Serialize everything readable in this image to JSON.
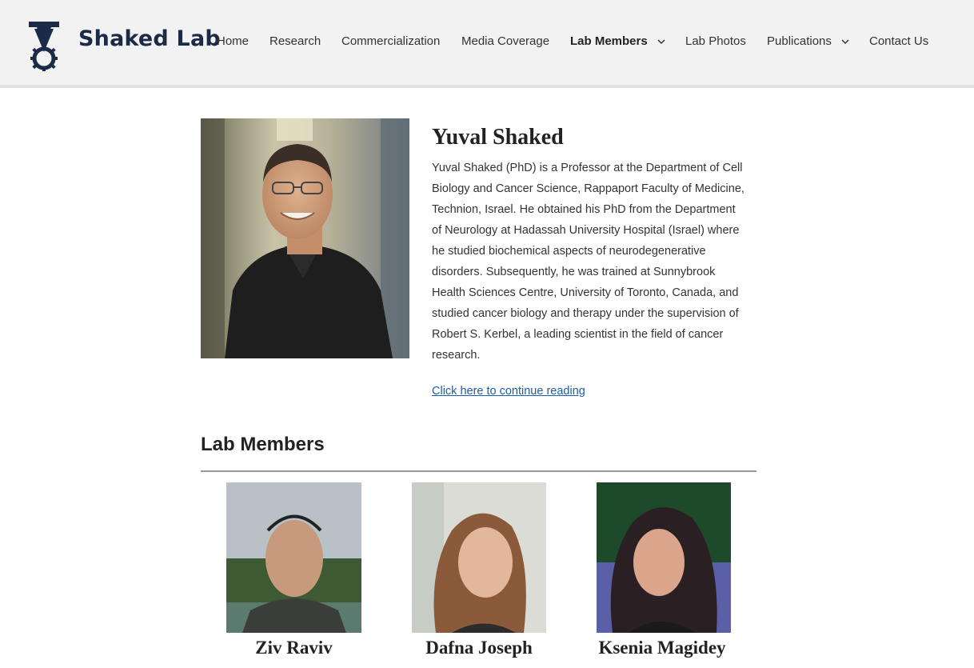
{
  "site": {
    "title": "Shaked Lab"
  },
  "nav": {
    "items": [
      {
        "label": "Home",
        "has_dropdown": false,
        "active": false
      },
      {
        "label": "Research",
        "has_dropdown": false,
        "active": false
      },
      {
        "label": "Commercialization",
        "has_dropdown": false,
        "active": false
      },
      {
        "label": "Media Coverage",
        "has_dropdown": false,
        "active": false
      },
      {
        "label": "Lab Members",
        "has_dropdown": true,
        "active": true
      },
      {
        "label": "Lab Photos",
        "has_dropdown": false,
        "active": false
      },
      {
        "label": "Publications",
        "has_dropdown": true,
        "active": false
      },
      {
        "label": "Contact Us",
        "has_dropdown": false,
        "active": false
      }
    ]
  },
  "profile": {
    "name": "Yuval Shaked",
    "bio_lines": [
      "Yuval Shaked (PhD) is a Professor at the Department of Cell",
      "Biology and Cancer Science, Rappaport Faculty of Medicine,",
      "Technion, Israel. He obtained his PhD from the Department",
      "of Neurology at Hadassah University Hospital (Israel) where",
      "he studied biochemical aspects of neurodegenerative",
      "disorders. Subsequently, he was trained at Sunnybrook",
      "Health Sciences Centre, University of Toronto, Canada, and",
      "studied cancer biology and therapy under the supervision of",
      "Robert S. Kerbel, a leading scientist in the field of cancer",
      "research."
    ],
    "continue_link": "Click here to continue reading"
  },
  "members": {
    "heading": "Lab Members",
    "list": [
      {
        "name": "Ziv Raviv"
      },
      {
        "name": "Dafna Joseph"
      },
      {
        "name": "Ksenia Magidey"
      }
    ]
  },
  "colors": {
    "header_bg": "#f2f2f2",
    "brand": "#1b2a47",
    "link": "#1a5fa8"
  }
}
